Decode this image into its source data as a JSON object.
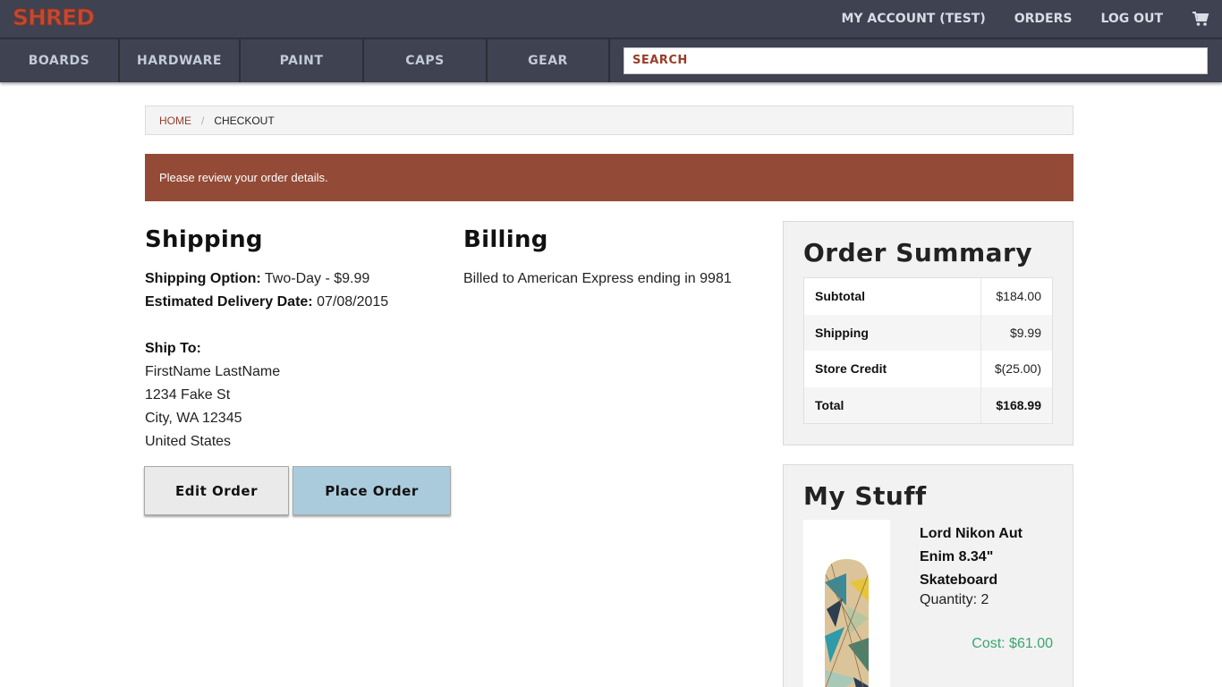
{
  "brand": {
    "logo": "SHRED",
    "logo_color": "#c04a33"
  },
  "header": {
    "links": [
      "MY ACCOUNT (TEST)",
      "ORDERS",
      "LOG OUT"
    ],
    "cart_icon": "cart-icon"
  },
  "nav": {
    "items": [
      "BOARDS",
      "HARDWARE",
      "PAINT",
      "CAPS",
      "GEAR"
    ],
    "search_placeholder": "SEARCH"
  },
  "breadcrumb": {
    "home": "HOME",
    "separator": "/",
    "current": "CHECKOUT"
  },
  "alert": {
    "message": "Please review your order details.",
    "color": "#934a36"
  },
  "shipping": {
    "title": "Shipping",
    "option_label": "Shipping Option:",
    "option_value": "Two-Day - $9.99",
    "delivery_label": "Estimated Delivery Date:",
    "delivery_value": "07/08/2015",
    "ship_to_label": "Ship To:",
    "address": [
      "FirstName LastName",
      "1234 Fake St",
      "City, WA 12345",
      "United States"
    ]
  },
  "billing": {
    "title": "Billing",
    "text": "Billed to American Express ending in 9981"
  },
  "actions": {
    "edit": "Edit Order",
    "place": "Place Order"
  },
  "order_summary": {
    "title": "Order Summary",
    "rows": [
      {
        "label": "Subtotal",
        "value": "$184.00"
      },
      {
        "label": "Shipping",
        "value": "$9.99"
      },
      {
        "label": "Store Credit",
        "value": "$(25.00)"
      },
      {
        "label": "Total",
        "value": "$168.99"
      }
    ]
  },
  "my_stuff": {
    "title": "My Stuff",
    "item": {
      "name": "Lord Nikon Aut Enim 8.34\" Skateboard",
      "quantity": "Quantity: 2",
      "cost": "Cost: $61.00",
      "cost_color": "#3aa76d"
    }
  }
}
